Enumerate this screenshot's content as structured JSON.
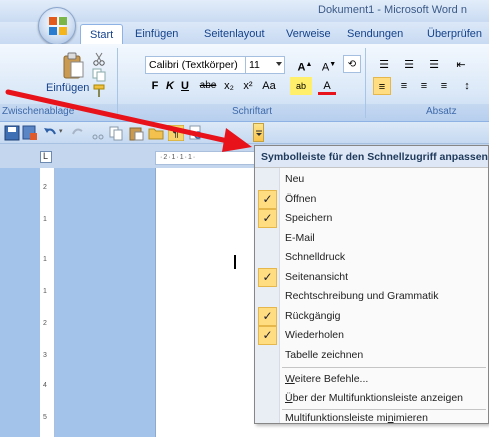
{
  "window": {
    "title": "Dokument1 - Microsoft Word n"
  },
  "tabs": [
    "Start",
    "Einfügen",
    "Seitenlayout",
    "Verweise",
    "Sendungen",
    "Überprüfen"
  ],
  "ribbon": {
    "paste_label": "Einfügen",
    "font_name": "Calibri (Textkörper)",
    "font_size": "11",
    "groups": [
      "Zwischenablage",
      "Schriftart",
      "Absatz"
    ],
    "format_buttons": [
      "F",
      "K",
      "U",
      "abe",
      "x₂",
      "x²",
      "Aa"
    ]
  },
  "menu": {
    "title": "Symbolleiste für den Schnellzugriff anpassen",
    "items": [
      {
        "label": "Neu",
        "checked": false
      },
      {
        "label": "Öffnen",
        "checked": true
      },
      {
        "label": "Speichern",
        "checked": true
      },
      {
        "label": "E-Mail",
        "checked": false
      },
      {
        "label": "Schnelldruck",
        "checked": false
      },
      {
        "label": "Seitenansicht",
        "checked": true
      },
      {
        "label": "Rechtschreibung und Grammatik",
        "checked": false
      },
      {
        "label": "Rückgängig",
        "checked": true
      },
      {
        "label": "Wiederholen",
        "checked": true
      },
      {
        "label": "Tabelle zeichnen",
        "checked": false
      }
    ],
    "more_commands": {
      "pre": "",
      "u": "W",
      "post": "eitere Befehle..."
    },
    "show_below": {
      "pre": "",
      "u": "Ü",
      "post": "ber der Multifunktionsleiste anzeigen"
    },
    "minimize": {
      "pre": "Multifunktionsleiste mi",
      "u": "n",
      "post": "imieren"
    },
    "check_glyph": "✓"
  },
  "ruler": {
    "h_text": "·2·1·1·1·",
    "v_numbers": [
      "2",
      "1",
      "1",
      "1",
      "2",
      "3",
      "4",
      "5"
    ]
  },
  "colors": {
    "accent": "#15428b",
    "arrow": "#e8121a",
    "menu_highlight": "#ffdd80"
  }
}
